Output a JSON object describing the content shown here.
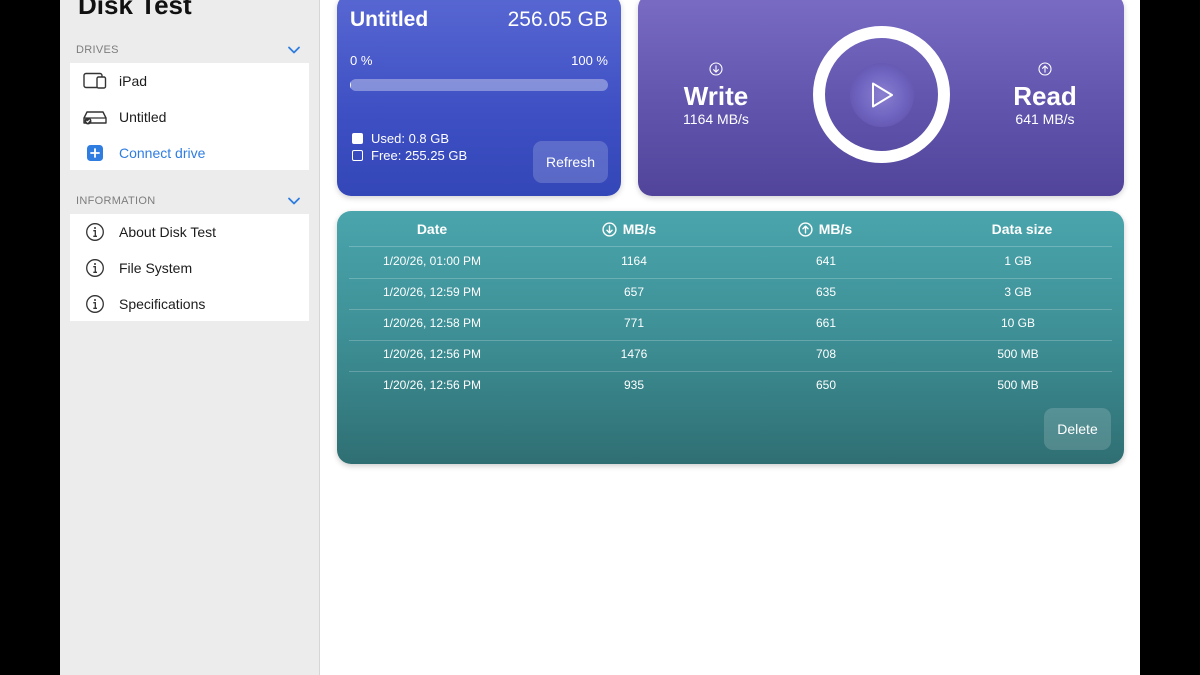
{
  "app": {
    "title": "Disk Test",
    "accent_color": "#2f7de1"
  },
  "sidebar": {
    "drives_header": "DRIVES",
    "drives": [
      {
        "label": "iPad",
        "icon": "ipad-icon"
      },
      {
        "label": "Untitled",
        "icon": "external-drive-icon"
      },
      {
        "label": "Connect drive",
        "icon": "plus-square-icon"
      }
    ],
    "info_header": "INFORMATION",
    "info_items": [
      {
        "label": "About Disk Test",
        "icon": "info-icon"
      },
      {
        "label": "File System",
        "icon": "info-icon"
      },
      {
        "label": "Specifications",
        "icon": "info-icon"
      }
    ]
  },
  "storage": {
    "drive_name": "Untitled",
    "capacity": "256.05 GB",
    "pct_min": "0 %",
    "pct_max": "100 %",
    "used_fraction": 0.003,
    "used_label": "Used: 0.8 GB",
    "free_label": "Free: 255.25 GB",
    "refresh_label": "Refresh"
  },
  "speed": {
    "write_label": "Write",
    "write_value": "1164 MB/s",
    "read_label": "Read",
    "read_value": "641 MB/s"
  },
  "history": {
    "headers": {
      "date": "Date",
      "write": "MB/s",
      "read": "MB/s",
      "size": "Data size"
    },
    "rows": [
      {
        "date": "1/20/26, 01:00 PM",
        "write": "1164",
        "read": "641",
        "size": "1 GB"
      },
      {
        "date": "1/20/26, 12:59 PM",
        "write": "657",
        "read": "635",
        "size": "3 GB"
      },
      {
        "date": "1/20/26, 12:58 PM",
        "write": "771",
        "read": "661",
        "size": "10 GB"
      },
      {
        "date": "1/20/26, 12:56 PM",
        "write": "1476",
        "read": "708",
        "size": "500 MB"
      },
      {
        "date": "1/20/26, 12:56 PM",
        "write": "935",
        "read": "650",
        "size": "500 MB"
      }
    ],
    "delete_label": "Delete"
  }
}
